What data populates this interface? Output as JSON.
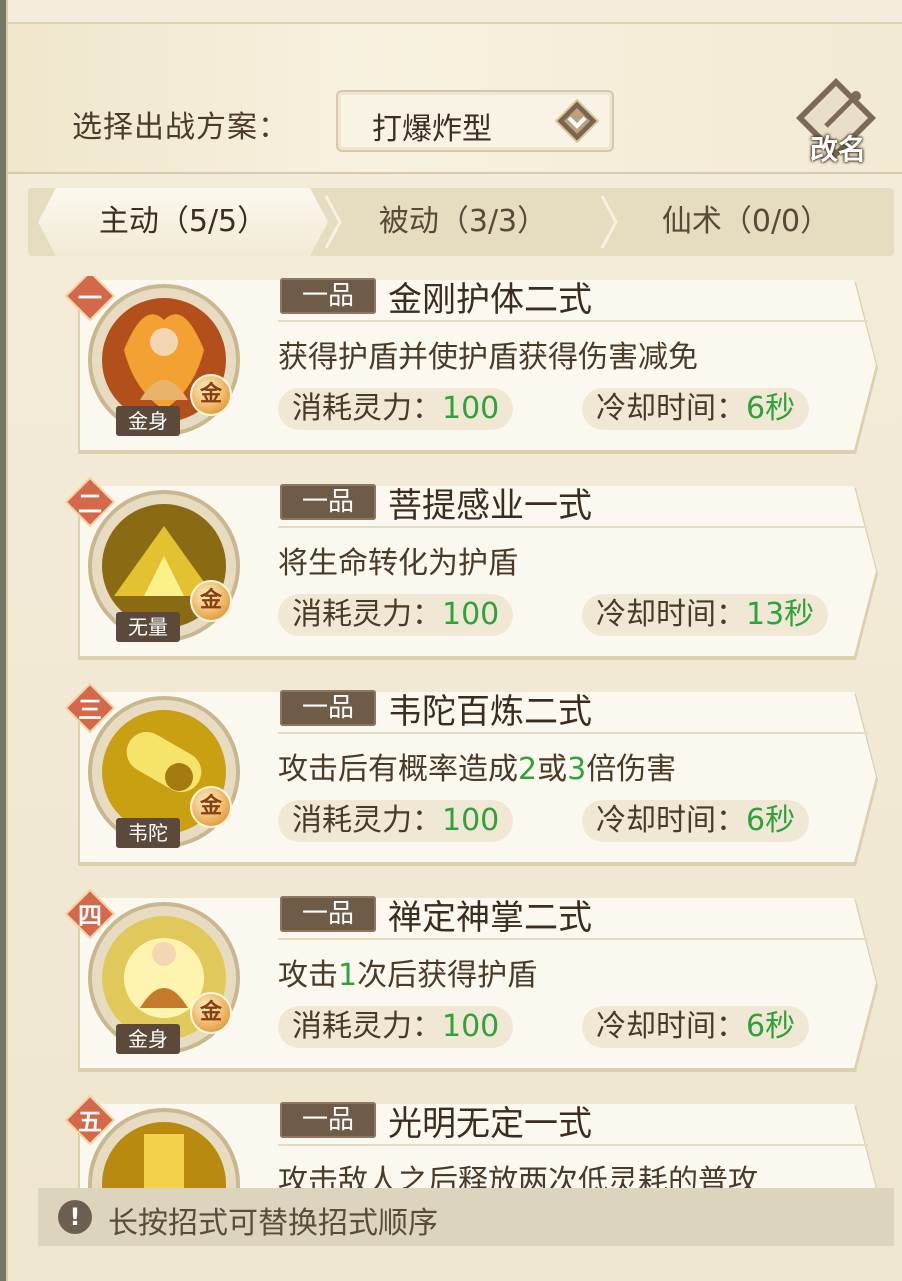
{
  "header": {
    "label": "选择出战方案：",
    "plan_value": "打爆炸型",
    "rename_label": "改名"
  },
  "tabs": [
    {
      "label": "主动（5/5）",
      "active": true
    },
    {
      "label": "被动（3/3）",
      "active": false
    },
    {
      "label": "仙术（0/0）",
      "active": false
    }
  ],
  "skills": [
    {
      "rank": "一",
      "grade": "一品",
      "name": "金刚护体二式",
      "desc": "获得护盾并使护盾获得伤害减免",
      "portrait_label": "金身",
      "element": "金",
      "cost_label": "消耗灵力：",
      "cost": "100",
      "cd_label": "冷却时间：",
      "cd": "6秒"
    },
    {
      "rank": "二",
      "grade": "一品",
      "name": "菩提感业一式",
      "desc": "将生命转化为护盾",
      "portrait_label": "无量",
      "element": "金",
      "cost_label": "消耗灵力：",
      "cost": "100",
      "cd_label": "冷却时间：",
      "cd": "13秒"
    },
    {
      "rank": "三",
      "grade": "一品",
      "name": "韦陀百炼二式",
      "desc_parts": [
        "攻击后有概率造成",
        "2",
        "或",
        "3",
        "倍伤害"
      ],
      "portrait_label": "韦陀",
      "element": "金",
      "cost_label": "消耗灵力：",
      "cost": "100",
      "cd_label": "冷却时间：",
      "cd": "6秒"
    },
    {
      "rank": "四",
      "grade": "一品",
      "name": "禅定神掌二式",
      "desc_parts": [
        "攻击",
        "1",
        "次后获得护盾"
      ],
      "portrait_label": "金身",
      "element": "金",
      "cost_label": "消耗灵力：",
      "cost": "100",
      "cd_label": "冷却时间：",
      "cd": "6秒"
    },
    {
      "rank": "五",
      "grade": "一品",
      "name": "光明无定一式",
      "desc": "攻击敌人之后释放两次低灵耗的普攻"
    }
  ],
  "footer": {
    "tip_icon": "!",
    "tip": "长按招式可替换招式顺序"
  },
  "colors": {
    "accent_green": "#2fa23a",
    "rank_badge": "#d4684a",
    "grade_bg": "#6e5b48"
  },
  "icons": {
    "dropdown": "diamond-chevron-icon",
    "rename": "brush-scroll-icon",
    "tip": "exclamation-icon"
  }
}
